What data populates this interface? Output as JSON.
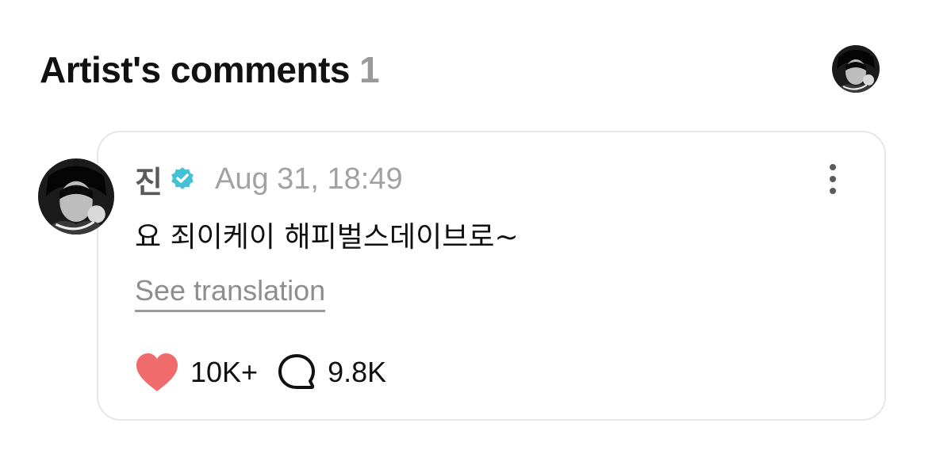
{
  "header": {
    "title": "Artist's comments",
    "count": "1",
    "avatar_icon": "profile-avatar"
  },
  "comment": {
    "author": "진",
    "verified_icon": "verified-badge-icon",
    "verified_color": "#45c1d6",
    "timestamp": "Aug 31, 18:49",
    "text": "요 죄이케이 해피벌스데이브로~",
    "translate_label": "See translation",
    "more_icon": "more-vertical-icon",
    "likes": {
      "icon": "heart-icon",
      "color": "#f06b6b",
      "count": "10K+"
    },
    "replies": {
      "icon": "comment-bubble-icon",
      "count": "9.8K"
    }
  }
}
